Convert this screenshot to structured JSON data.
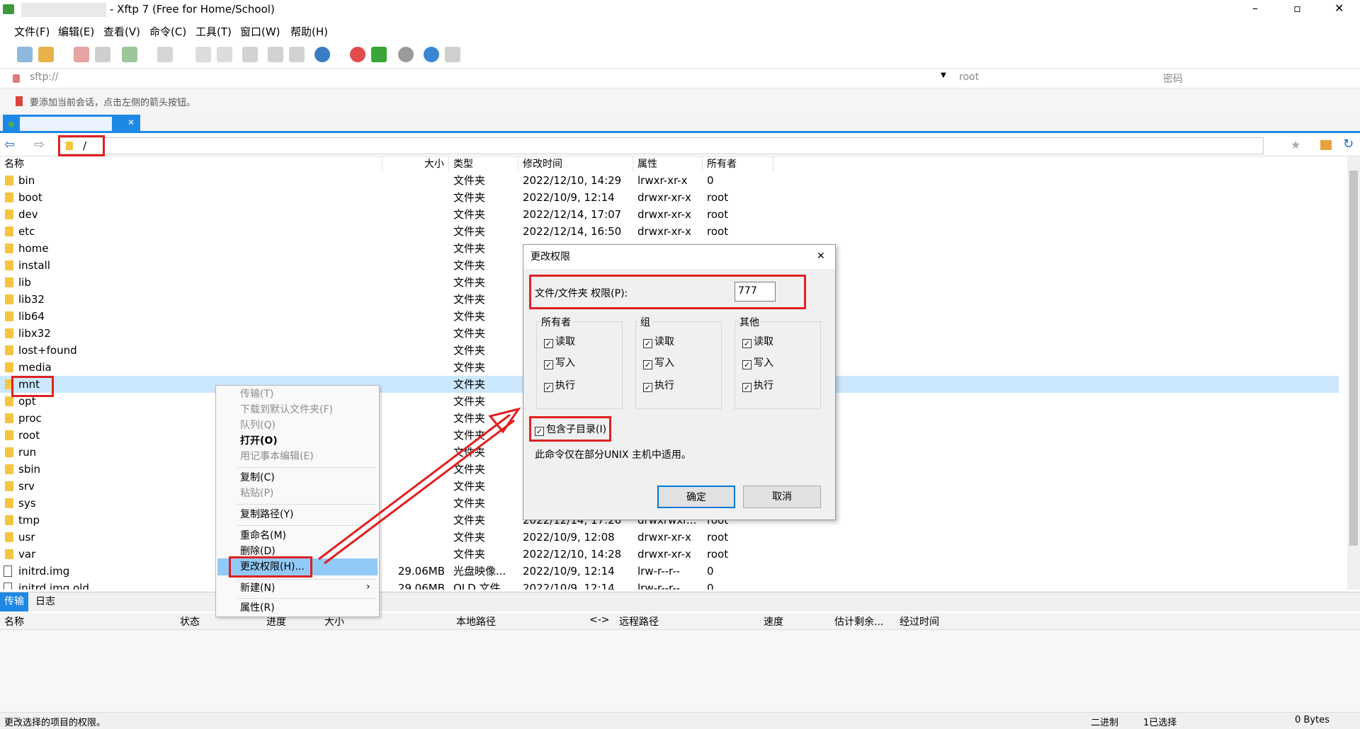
{
  "window": {
    "title": "- Xftp 7 (Free for Home/School)",
    "min": "–",
    "max": "▫",
    "close": "✕"
  },
  "menu": [
    "文件(F)",
    "编辑(E)",
    "查看(V)",
    "命令(C)",
    "工具(T)",
    "窗口(W)",
    "帮助(H)"
  ],
  "address": {
    "url": "sftp://",
    "user": "root",
    "password_placeholder": "密码"
  },
  "hint": "要添加当前会话，点击左侧的箭头按钮。",
  "path": "/",
  "columns": [
    "名称",
    "大小",
    "类型",
    "修改时间",
    "属性",
    "所有者"
  ],
  "files": [
    {
      "name": "bin",
      "size": "",
      "type": "文件夹",
      "mtime": "2022/12/10, 14:29",
      "attr": "lrwxr-xr-x",
      "owner": "0",
      "kind": "link"
    },
    {
      "name": "boot",
      "size": "",
      "type": "文件夹",
      "mtime": "2022/10/9, 12:14",
      "attr": "drwxr-xr-x",
      "owner": "root",
      "kind": "folder"
    },
    {
      "name": "dev",
      "size": "",
      "type": "文件夹",
      "mtime": "2022/12/14, 17:07",
      "attr": "drwxr-xr-x",
      "owner": "root",
      "kind": "folder"
    },
    {
      "name": "etc",
      "size": "",
      "type": "文件夹",
      "mtime": "2022/12/14, 16:50",
      "attr": "drwxr-xr-x",
      "owner": "root",
      "kind": "folder"
    },
    {
      "name": "home",
      "size": "",
      "type": "文件夹",
      "mtime": "",
      "attr": "",
      "owner": "",
      "kind": "folder"
    },
    {
      "name": "install",
      "size": "",
      "type": "文件夹",
      "mtime": "",
      "attr": "",
      "owner": "",
      "kind": "folder"
    },
    {
      "name": "lib",
      "size": "",
      "type": "文件夹",
      "mtime": "",
      "attr": "",
      "owner": "",
      "kind": "link"
    },
    {
      "name": "lib32",
      "size": "",
      "type": "文件夹",
      "mtime": "",
      "attr": "",
      "owner": "",
      "kind": "link"
    },
    {
      "name": "lib64",
      "size": "",
      "type": "文件夹",
      "mtime": "",
      "attr": "",
      "owner": "",
      "kind": "link"
    },
    {
      "name": "libx32",
      "size": "",
      "type": "文件夹",
      "mtime": "",
      "attr": "",
      "owner": "",
      "kind": "link"
    },
    {
      "name": "lost+found",
      "size": "",
      "type": "文件夹",
      "mtime": "",
      "attr": "",
      "owner": "",
      "kind": "folder"
    },
    {
      "name": "media",
      "size": "",
      "type": "文件夹",
      "mtime": "",
      "attr": "",
      "owner": "",
      "kind": "folder"
    },
    {
      "name": "mnt",
      "size": "",
      "type": "文件夹",
      "mtime": "",
      "attr": "",
      "owner": "",
      "kind": "folder"
    },
    {
      "name": "opt",
      "size": "",
      "type": "文件夹",
      "mtime": "",
      "attr": "",
      "owner": "",
      "kind": "folder"
    },
    {
      "name": "proc",
      "size": "",
      "type": "文件夹",
      "mtime": "",
      "attr": "",
      "owner": "",
      "kind": "folder"
    },
    {
      "name": "root",
      "size": "",
      "type": "文件夹",
      "mtime": "",
      "attr": "",
      "owner": "",
      "kind": "folder"
    },
    {
      "name": "run",
      "size": "",
      "type": "文件夹",
      "mtime": "",
      "attr": "",
      "owner": "",
      "kind": "folder"
    },
    {
      "name": "sbin",
      "size": "",
      "type": "文件夹",
      "mtime": "",
      "attr": "",
      "owner": "",
      "kind": "link"
    },
    {
      "name": "srv",
      "size": "",
      "type": "文件夹",
      "mtime": "",
      "attr": "",
      "owner": "",
      "kind": "folder"
    },
    {
      "name": "sys",
      "size": "",
      "type": "文件夹",
      "mtime": "",
      "attr": "",
      "owner": "",
      "kind": "folder"
    },
    {
      "name": "tmp",
      "size": "",
      "type": "文件夹",
      "mtime": "2022/12/14, 17:26",
      "attr": "drwxrwxr...",
      "owner": "root",
      "kind": "folder"
    },
    {
      "name": "usr",
      "size": "",
      "type": "文件夹",
      "mtime": "2022/10/9, 12:08",
      "attr": "drwxr-xr-x",
      "owner": "root",
      "kind": "folder"
    },
    {
      "name": "var",
      "size": "",
      "type": "文件夹",
      "mtime": "2022/12/10, 14:28",
      "attr": "drwxr-xr-x",
      "owner": "root",
      "kind": "folder"
    },
    {
      "name": "initrd.img",
      "size": "29.06MB",
      "type": "光盘映像...",
      "mtime": "2022/10/9, 12:14",
      "attr": "lrw-r--r--",
      "owner": "0",
      "kind": "file"
    },
    {
      "name": "initrd.img.old",
      "size": "29.06MB",
      "type": "OLD 文件",
      "mtime": "2022/10/9, 12:14",
      "attr": "lrw-r--r--",
      "owner": "0",
      "kind": "file"
    }
  ],
  "context_menu": [
    {
      "label": "传输(T)",
      "disabled": true
    },
    {
      "label": "下载到默认文件夹(F)",
      "disabled": true
    },
    {
      "label": "队列(Q)",
      "disabled": true
    },
    {
      "label": "打开(O)",
      "disabled": false,
      "bold": true
    },
    {
      "label": "用记事本编辑(E)",
      "disabled": true
    },
    {
      "label": "复制(C)",
      "disabled": false
    },
    {
      "label": "粘贴(P)",
      "disabled": true
    },
    {
      "label": "复制路径(Y)",
      "disabled": false
    },
    {
      "label": "重命名(M)",
      "disabled": false
    },
    {
      "label": "删除(D)",
      "disabled": false
    },
    {
      "label": "更改权限(H)...",
      "disabled": false,
      "highlight": true
    },
    {
      "label": "新建(N)",
      "disabled": false,
      "submenu": "›"
    },
    {
      "label": "属性(R)",
      "disabled": false
    }
  ],
  "dialog": {
    "title": "更改权限",
    "perm_label": "文件/文件夹 权限(P):",
    "perm_value": "777",
    "groups": [
      {
        "title": "所有者",
        "items": [
          "读取",
          "写入",
          "执行"
        ]
      },
      {
        "title": "组",
        "items": [
          "读取",
          "写入",
          "执行"
        ]
      },
      {
        "title": "其他",
        "items": [
          "读取",
          "写入",
          "执行"
        ]
      }
    ],
    "recursive_label": "包含子目录(I)",
    "note": "此命令仅在部分UNIX 主机中适用。",
    "ok": "确定",
    "cancel": "取消",
    "check": "✓",
    "close": "✕"
  },
  "bottom_tabs": [
    "传输",
    "日志"
  ],
  "transfer_columns": [
    "名称",
    "状态",
    "进度",
    "大小",
    "本地路径",
    "<->",
    "远程路径",
    "速度",
    "估计剩余...",
    "经过时间"
  ],
  "status": {
    "left": "更改选择的项目的权限。",
    "mode": "二进制",
    "selected": "1已选择",
    "size": "0 Bytes"
  },
  "colors": {
    "accent": "#1e88e5",
    "red": "#e02020",
    "selected": "#cce8ff",
    "menu_hl": "#91c9f7"
  }
}
